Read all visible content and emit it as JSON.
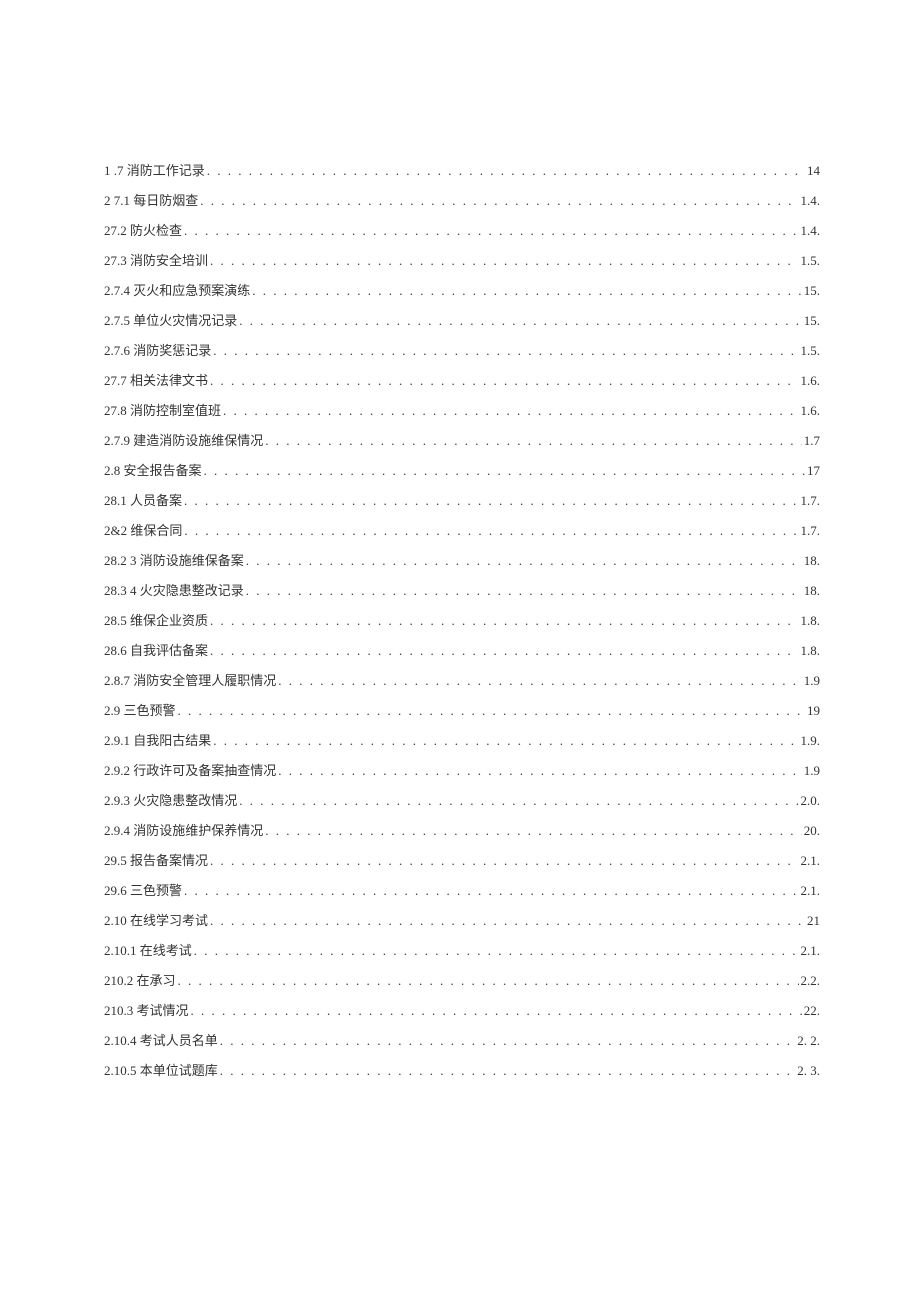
{
  "toc": [
    {
      "label": "1    .7 消防工作记录",
      "page": "14"
    },
    {
      "label": "2    7.1 每日防烟查",
      "page": "1.4."
    },
    {
      "label": "27.2 防火检查",
      "page": "1.4."
    },
    {
      "label": "27.3 消防安全培训",
      "page": "1.5."
    },
    {
      "label": "2.7.4 灭火和应急预案演练",
      "page": "15."
    },
    {
      "label": "2.7.5 单位火灾情况记录",
      "page": "15."
    },
    {
      "label": "2.7.6 消防奖惩记录",
      "page": "1.5."
    },
    {
      "label": "27.7 相关法律文书",
      "page": "1.6."
    },
    {
      "label": "27.8 消防控制室值班",
      "page": "1.6."
    },
    {
      "label": "2.7.9 建造消防设施维保情况",
      "page": "1.7"
    },
    {
      "label": "2.8 安全报告备案",
      "page": "17"
    },
    {
      "label": "28.1      人员备案",
      "page": "1.7."
    },
    {
      "label": "2&2 维保合同",
      "page": "1.7."
    },
    {
      "label": "28.2    3 消防设施维保备案",
      "page": "18."
    },
    {
      "label": "28.3    4 火灾隐患整改记录",
      "page": "18."
    },
    {
      "label": "28.5      维保企业资质",
      "page": "1.8."
    },
    {
      "label": "28.6      自我评估备案",
      "page": "1.8."
    },
    {
      "label": "2.8.7 消防安全管理人履职情况",
      "page": "1.9"
    },
    {
      "label": "2.9 三色预警",
      "page": "19"
    },
    {
      "label": "2.9.1      自我阳古结果",
      "page": "1.9."
    },
    {
      "label": "2.9.2      行政许可及备案抽查情况",
      "page": "1.9"
    },
    {
      "label": "2.9.3      火灾隐患整改情况",
      "page": "2.0."
    },
    {
      "label": "2.9.4      消防设施维护保养情况",
      "page": "20."
    },
    {
      "label": "29.5 报告备案情况",
      "page": "2.1."
    },
    {
      "label": "29.6 三色预警",
      "page": "2.1."
    },
    {
      "label": "2.10 在线学习考试",
      "page": "21"
    },
    {
      "label": "2.10.1    在线考试",
      "page": "2.1."
    },
    {
      "label": "210.2 在承习",
      "page": "2.2."
    },
    {
      "label": "210.3 考试情况",
      "page": "22."
    },
    {
      "label": "2.10.4 考试人员名单",
      "page": "2.    2."
    },
    {
      "label": "2.10.5 本单位试题库",
      "page": "2.    3."
    }
  ]
}
